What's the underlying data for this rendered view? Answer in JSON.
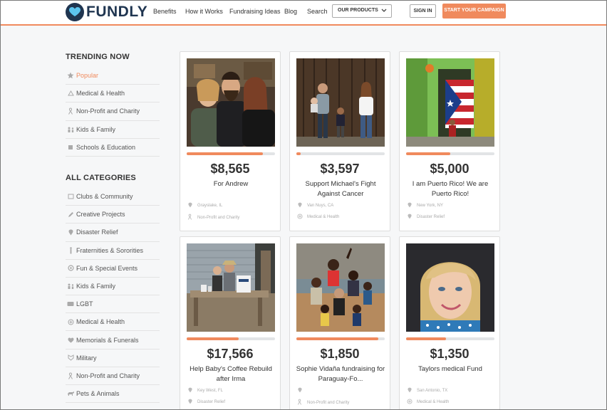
{
  "brand": {
    "name": "FUNDLY"
  },
  "nav": {
    "benefits": "Benefits",
    "how": "How it Works",
    "ideas": "Fundraising Ideas",
    "blog": "Blog",
    "search": "Search",
    "products": "OUR PRODUCTS",
    "signin": "SIGN IN",
    "campaign": "START YOUR CAMPAIGN"
  },
  "trending": {
    "heading": "TRENDING NOW",
    "items": [
      {
        "label": "Popular",
        "icon": "star-icon",
        "active": true
      },
      {
        "label": "Medical & Health",
        "icon": "medical-icon"
      },
      {
        "label": "Non-Profit and Charity",
        "icon": "ribbon-icon"
      },
      {
        "label": "Kids & Family",
        "icon": "family-icon"
      },
      {
        "label": "Schools & Education",
        "icon": "book-icon"
      }
    ]
  },
  "categories": {
    "heading": "ALL CATEGORIES",
    "items": [
      {
        "label": "Clubs & Community",
        "icon": "clubs-icon"
      },
      {
        "label": "Creative Projects",
        "icon": "pencil-icon"
      },
      {
        "label": "Disaster Relief",
        "icon": "pin-icon"
      },
      {
        "label": "Fraternities & Sororities",
        "icon": "torch-icon"
      },
      {
        "label": "Fun & Special Events",
        "icon": "event-icon"
      },
      {
        "label": "Kids & Family",
        "icon": "family-icon"
      },
      {
        "label": "LGBT",
        "icon": "lgbt-icon"
      },
      {
        "label": "Medical & Health",
        "icon": "medical-icon"
      },
      {
        "label": "Memorials & Funerals",
        "icon": "heart-icon"
      },
      {
        "label": "Military",
        "icon": "military-icon"
      },
      {
        "label": "Non-Profit and Charity",
        "icon": "ribbon-icon"
      },
      {
        "label": "Pets & Animals",
        "icon": "paw-icon"
      }
    ]
  },
  "campaigns": [
    {
      "amount": "$8,565",
      "title": "For Andrew",
      "location": "Grayslake, IL",
      "category": "Non-Profit and Charity",
      "progress": 0.86
    },
    {
      "amount": "$3,597",
      "title": "Support Michael's Fight Against Cancer",
      "location": "Van Nuys, CA",
      "category": "Medical & Health",
      "progress": 0.05
    },
    {
      "amount": "$5,000",
      "title": "I am Puerto Rico! We are Puerto Rico!",
      "location": "New York, NY",
      "category": "Disaster Relief",
      "progress": 0.5
    },
    {
      "amount": "$17,566",
      "title": "Help Baby's Coffee Rebuild after Irma",
      "location": "Key West, FL",
      "category": "Disaster Relief",
      "progress": 0.59
    },
    {
      "amount": "$1,850",
      "title": "Sophie Vidaña fundraising for Paraguay-Fo...",
      "location": "",
      "category": "Non-Profit and Charity",
      "progress": 0.93
    },
    {
      "amount": "$1,350",
      "title": "Taylors medical Fund",
      "location": "San Antonio, TX",
      "category": "Medical & Health",
      "progress": 0.45
    }
  ],
  "colors": {
    "accent": "#f08a5d",
    "brand": "#1f3550",
    "track": "#e2e4e6"
  }
}
